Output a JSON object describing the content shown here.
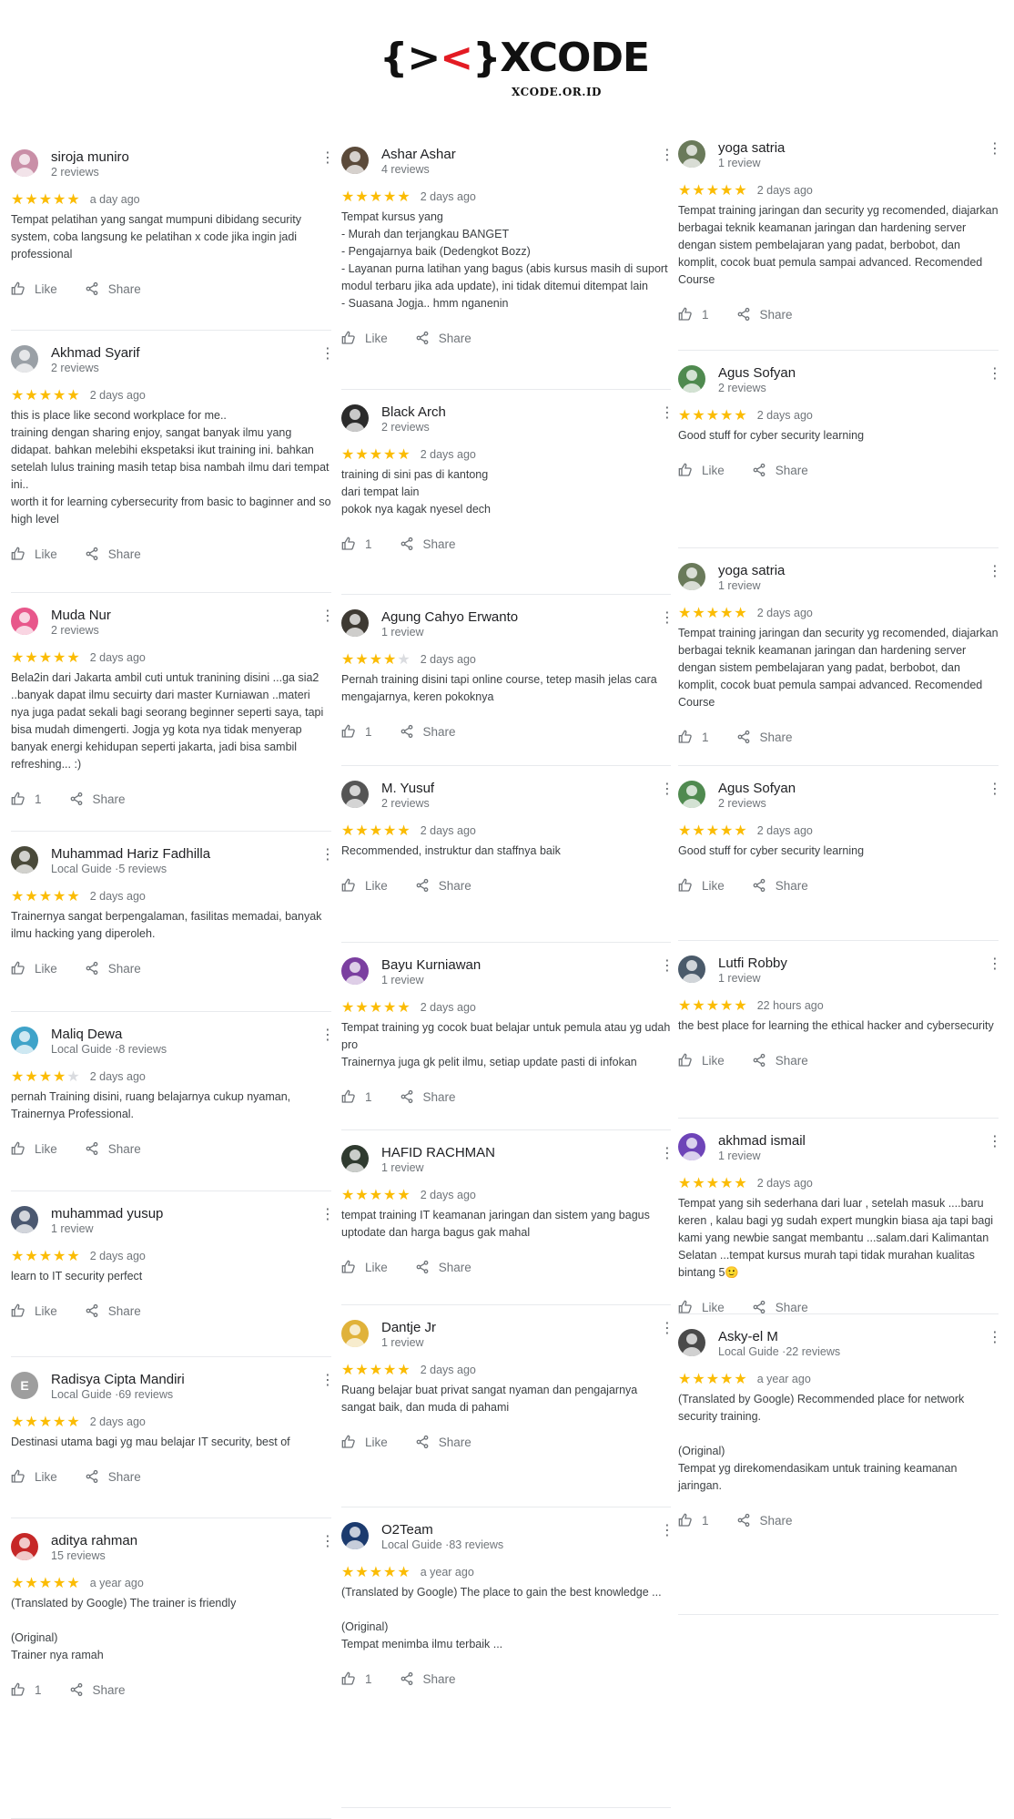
{
  "brand": {
    "open": "{>",
    "x": "<",
    "close": "}",
    "name": "XCODE",
    "domain": "XCODE.OR.ID"
  },
  "labels": {
    "like": "Like",
    "share": "Share"
  },
  "columns": [
    [
      {
        "name": "siroja muniro",
        "meta": "2 reviews",
        "stars": 5,
        "date": "a day ago",
        "text": "Tempat pelatihan yang sangat mumpuni dibidang security system, coba langsung ke pelatihan x code jika ingin jadi professional",
        "likes": "",
        "avatar": "icon",
        "color": "#c98fa7"
      },
      {
        "name": "Akhmad Syarif",
        "meta": "2 reviews",
        "stars": 5,
        "date": "2 days ago",
        "text": "this is place like second workplace for me..\ntraining dengan sharing enjoy, sangat banyak ilmu yang didapat. bahkan melebihi ekspetaksi ikut training ini. bahkan setelah lulus training masih tetap bisa nambah ilmu dari tempat ini..\nworth it for learning cybersecurity from basic to baginner and so high level",
        "likes": "",
        "avatar": "icon",
        "color": "#9aa0a6"
      },
      {
        "name": "Muda Nur",
        "meta": "2 reviews",
        "stars": 5,
        "date": "2 days ago",
        "text": "Bela2in dari Jakarta ambil cuti untuk tranining disini ...ga sia2 ..banyak dapat ilmu secuirty dari master Kurniawan ..materi nya juga padat sekali bagi seorang beginner seperti saya, tapi bisa mudah dimengerti. Jogja yg kota nya tidak menyerap banyak energi kehidupan seperti jakarta, jadi bisa sambil refreshing... :)",
        "likes": "1",
        "avatar": "icon",
        "color": "#e8578b"
      },
      {
        "name": "Muhammad Hariz Fadhilla",
        "meta": "Local Guide ·5 reviews",
        "stars": 5,
        "date": "2 days ago",
        "text": "Trainernya sangat berpengalaman, fasilitas memadai, banyak ilmu hacking yang diperoleh.",
        "likes": "",
        "avatar": "icon",
        "color": "#4a4a3a"
      },
      {
        "name": "Maliq Dewa",
        "meta": "Local Guide ·8 reviews",
        "stars": 4,
        "date": "2 days ago",
        "text": "pernah Training disini, ruang belajarnya cukup nyaman, Trainernya Professional.",
        "likes": "",
        "avatar": "icon",
        "color": "#3fa3c9"
      },
      {
        "name": "muhammad yusup",
        "meta": "1 review",
        "stars": 5,
        "date": "2 days ago",
        "text": "learn to IT security perfect",
        "likes": "",
        "avatar": "icon",
        "color": "#4b5870"
      },
      {
        "name": "Radisya Cipta Mandiri",
        "meta": "Local Guide ·69 reviews",
        "stars": 5,
        "date": "2 days ago",
        "text": "Destinasi utama bagi yg mau belajar IT security, best of",
        "likes": "",
        "avatar": "E",
        "color": "#9e9e9e"
      },
      {
        "name": "aditya rahman",
        "meta": "15 reviews",
        "stars": 5,
        "date": "a year ago",
        "text": "(Translated by Google) The trainer is friendly\n\n(Original)\nTrainer nya ramah",
        "likes": "1",
        "avatar": "icon",
        "color": "#c62828"
      }
    ],
    [
      {
        "name": "Ashar Ashar",
        "meta": "4 reviews",
        "stars": 5,
        "date": "2 days ago",
        "text": "Tempat kursus yang\n- Murah dan terjangkau BANGET\n- Pengajarnya baik (Dedengkot Bozz)\n- Layanan purna latihan yang bagus (abis kursus masih di suport modul terbaru jika ada update), ini tidak ditemui ditempat lain\n- Suasana Jogja.. hmm nganenin",
        "likes": "",
        "avatar": "icon",
        "color": "#5b4a3a"
      },
      {
        "name": "Black Arch",
        "meta": "2 reviews",
        "stars": 5,
        "date": "2 days ago",
        "text": "training di sini pas di kantong\ndari tempat lain\npokok nya kagak nyesel dech",
        "likes": "1",
        "avatar": "icon",
        "color": "#2b2b2b"
      },
      {
        "name": "Agung Cahyo Erwanto",
        "meta": "1 review",
        "stars": 4,
        "date": "2 days ago",
        "text": "Pernah training disini tapi online course, tetep masih jelas cara mengajarnya, keren pokoknya",
        "likes": "1",
        "avatar": "icon",
        "color": "#3e3a33"
      },
      {
        "name": "M. Yusuf",
        "meta": "2 reviews",
        "stars": 5,
        "date": "2 days ago",
        "text": "Recommended, instruktur dan staffnya baik",
        "likes": "",
        "avatar": "icon",
        "color": "#555555"
      },
      {
        "name": "Bayu Kurniawan",
        "meta": "1 review",
        "stars": 5,
        "date": "2 days ago",
        "text": "Tempat training yg cocok buat belajar untuk pemula atau yg udah pro\nTrainernya juga gk pelit ilmu, setiap update pasti di infokan",
        "likes": "1",
        "avatar": "icon",
        "color": "#7b3fa0"
      },
      {
        "name": "HAFID RACHMAN",
        "meta": "1 review",
        "stars": 5,
        "date": "2 days ago",
        "text": "tempat training IT keamanan jaringan dan sistem yang bagus uptodate dan harga bagus gak mahal",
        "likes": "",
        "avatar": "icon",
        "color": "#2f3a2f"
      },
      {
        "name": "Dantje Jr",
        "meta": "1 review",
        "stars": 5,
        "date": "2 days ago",
        "text": "Ruang belajar buat privat sangat nyaman dan pengajarnya sangat baik, dan muda di pahami",
        "likes": "",
        "avatar": "icon",
        "color": "#e0b23a"
      },
      {
        "name": "O2Team",
        "meta": "Local Guide ·83 reviews",
        "stars": 5,
        "date": "a year ago",
        "text": "(Translated by Google) The place to gain the best knowledge ...\n\n(Original)\nTempat menimba ilmu terbaik ...",
        "likes": "1",
        "avatar": "icon",
        "color": "#1c3b6e"
      }
    ],
    [
      {
        "name": "yoga satria",
        "meta": "1 review",
        "stars": 5,
        "date": "2 days ago",
        "text": "Tempat training jaringan dan security yg recomended, diajarkan berbagai teknik keamanan jaringan dan hardening server dengan sistem pembelajaran yang padat, berbobot, dan komplit, cocok buat pemula sampai advanced. Recomended Course",
        "likes": "1",
        "avatar": "icon",
        "color": "#6a7a5a"
      },
      {
        "name": "Agus Sofyan",
        "meta": "2 reviews",
        "stars": 5,
        "date": "2 days ago",
        "text": "Good stuff for cyber security learning",
        "likes": "",
        "avatar": "icon",
        "color": "#4f8a4f"
      },
      {
        "name": "yoga satria",
        "meta": "1 review",
        "stars": 5,
        "date": "2 days ago",
        "text": "Tempat training jaringan dan security yg recomended, diajarkan berbagai teknik keamanan jaringan dan hardening server dengan sistem pembelajaran yang padat, berbobot, dan komplit, cocok buat pemula sampai advanced. Recomended Course",
        "likes": "1",
        "avatar": "icon",
        "color": "#6a7a5a"
      },
      {
        "name": "Agus Sofyan",
        "meta": "2 reviews",
        "stars": 5,
        "date": "2 days ago",
        "text": "Good stuff for cyber security learning",
        "likes": "",
        "avatar": "icon",
        "color": "#4f8a4f"
      },
      {
        "name": "Lutfi Robby",
        "meta": "1 review",
        "stars": 5,
        "date": "22 hours ago",
        "text": "the best place for learning the ethical hacker and cybersecurity",
        "likes": "",
        "avatar": "icon",
        "color": "#4a5a6a"
      },
      {
        "name": "akhmad ismail",
        "meta": "1 review",
        "stars": 5,
        "date": "2 days ago",
        "text": "Tempat yang sih sederhana dari luar , setelah masuk ....baru keren , kalau bagi yg sudah expert mungkin biasa aja tapi bagi kami yang newbie sangat membantu ...salam.dari Kalimantan Selatan ...tempat kursus murah tapi tidak murahan kualitas bintang 5🙂",
        "likes": "",
        "avatar": "icon",
        "color": "#6e44b8"
      },
      {
        "name": "Asky-el M",
        "meta": "Local Guide ·22 reviews",
        "stars": 5,
        "date": "a year ago",
        "text": "(Translated by Google) Recommended place for network security training.\n\n(Original)\nTempat yg direkomendasikam untuk training keamanan jaringan.",
        "likes": "1",
        "avatar": "icon",
        "color": "#4a4a4a"
      }
    ]
  ],
  "colors": {
    "star": "#fbbc04",
    "meta": "#70757a",
    "text": "#3c4043",
    "brand_red": "#e31b23"
  }
}
